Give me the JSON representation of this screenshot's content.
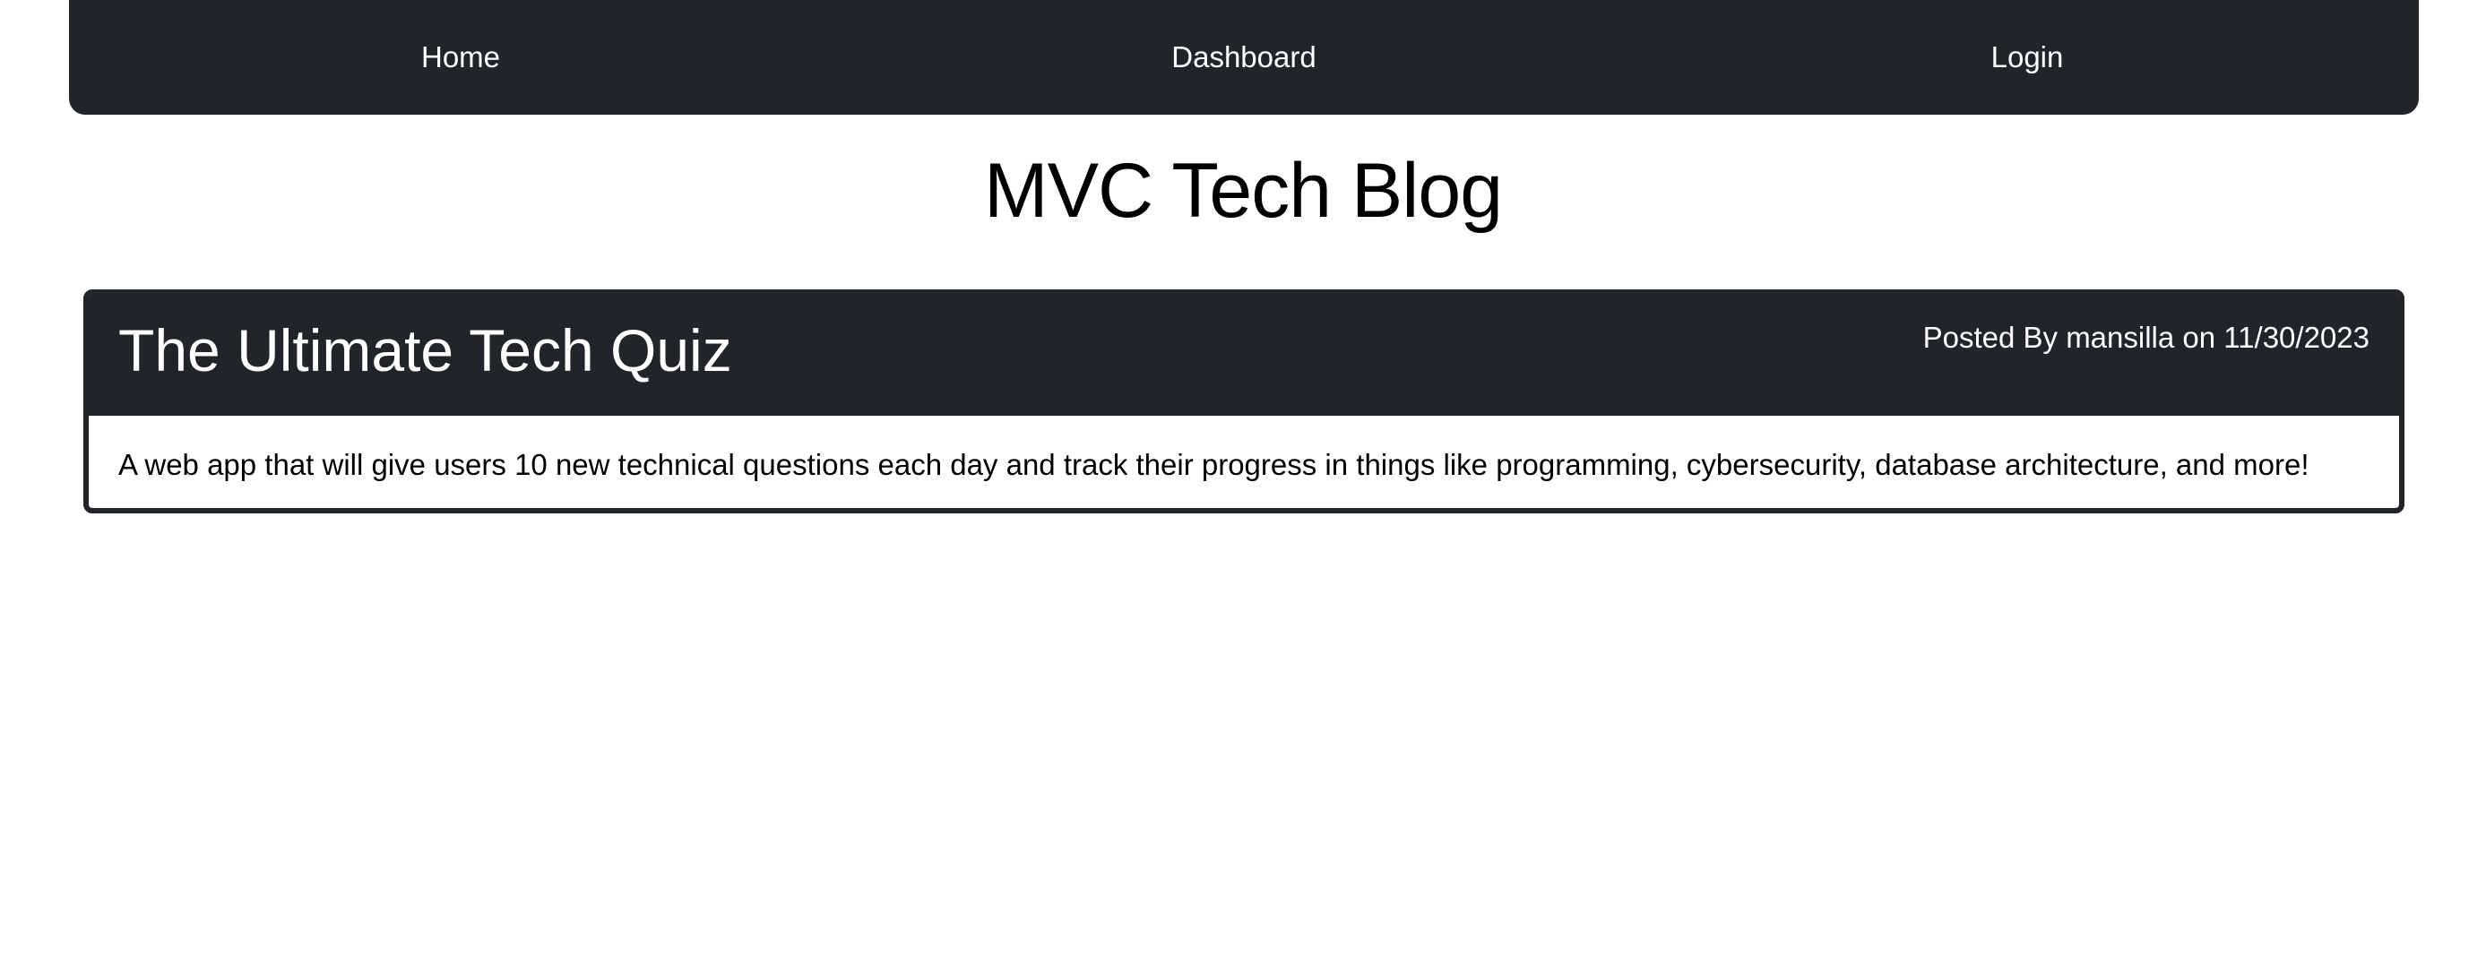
{
  "nav": {
    "items": [
      {
        "label": "Home"
      },
      {
        "label": "Dashboard"
      },
      {
        "label": "Login"
      }
    ]
  },
  "header": {
    "title": "MVC Tech Blog"
  },
  "posts": [
    {
      "title": "The Ultimate Tech Quiz",
      "meta": "Posted By mansilla on 11/30/2023",
      "body": "A web app that will give users 10 new technical questions each day and track their progress in things like programming, cybersecurity, database architecture, and more!"
    }
  ],
  "colors": {
    "navbar_bg": "#212529",
    "card_header_bg": "#212529",
    "text_light": "#ffffff",
    "text_dark": "#000000"
  }
}
